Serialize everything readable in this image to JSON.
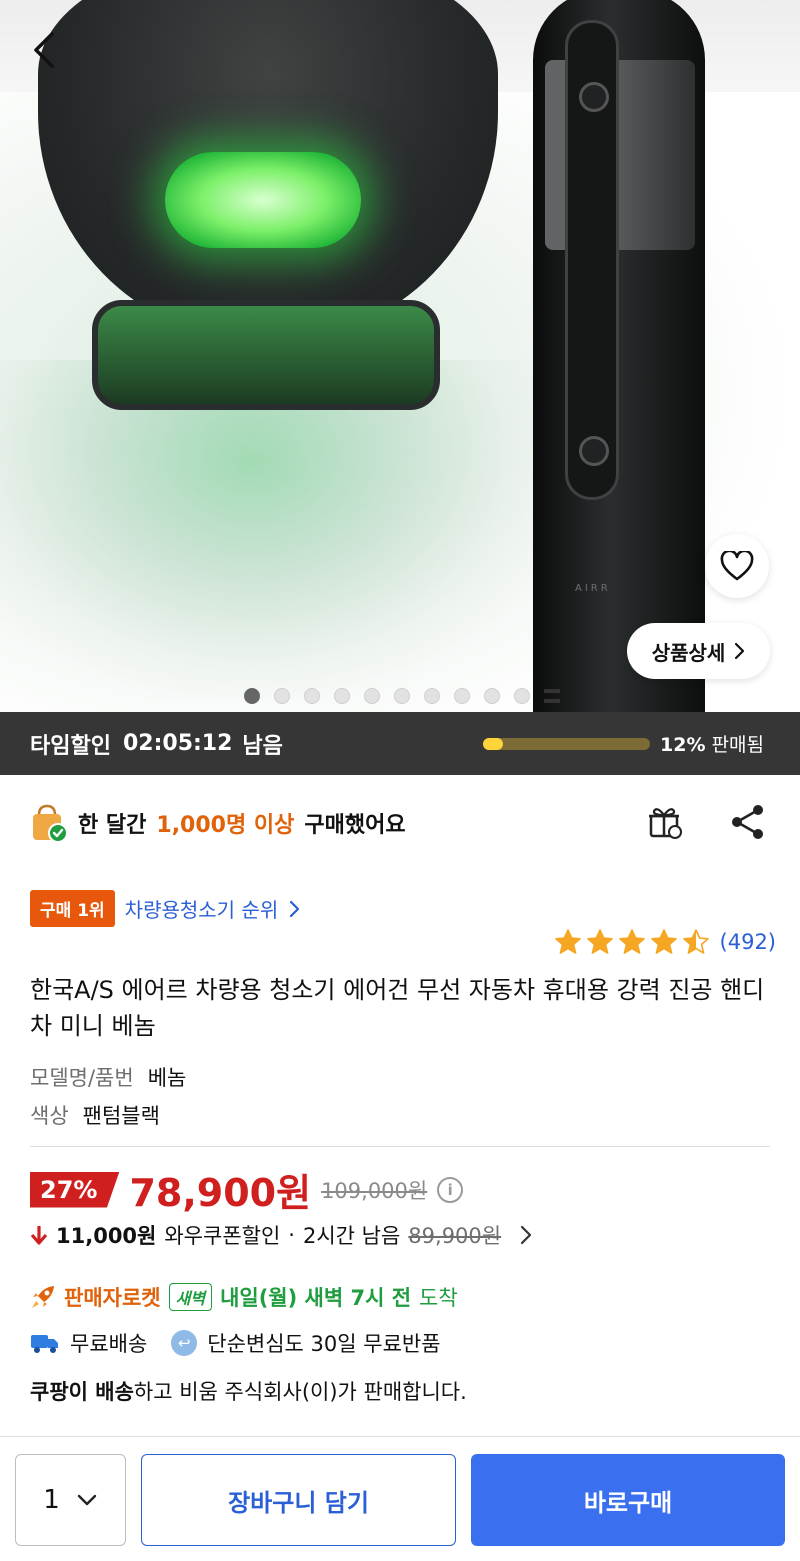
{
  "hero": {
    "brand_mark": "AIRR",
    "image_count": 10,
    "active_index": 0
  },
  "actions": {
    "detail_label": "상품상세"
  },
  "timedeal": {
    "label": "타임할인",
    "countdown": "02:05:12",
    "remain_suffix": "남음",
    "sold_percent_value": 12,
    "sold_percent": "12%",
    "sold_suffix": "판매됨"
  },
  "purchase_banner": {
    "prefix": "한 달간",
    "highlight": "1,000명 이상",
    "suffix": "구매했어요"
  },
  "rank": {
    "badge": "구매 1위",
    "category_link": "차량용청소기 순위"
  },
  "rating": {
    "stars": 4.5,
    "count": "(492)"
  },
  "product": {
    "title": "한국A/S 에어르 차량용 청소기 에어건 무선 자동차 휴대용 강력 진공 핸디 차 미니 베놈",
    "specs": [
      {
        "key": "모델명/품번",
        "value": "베놈"
      },
      {
        "key": "색상",
        "value": "팬텀블랙"
      }
    ]
  },
  "price": {
    "discount": "27%",
    "sale_price": "78,900원",
    "original_price": "109,000원"
  },
  "coupon": {
    "amount": "11,000원",
    "label": "와우쿠폰할인",
    "separator": "·",
    "time_left": "2시간 남음",
    "coupon_price": "89,900원"
  },
  "delivery": {
    "rocket_label": "판매자로켓",
    "dawn_badge": "새벽",
    "arrival": "내일(월) 새벽 7시 전",
    "arrival_suffix": "도착"
  },
  "shipping": {
    "free_shipping": "무료배송",
    "free_return": "단순변심도 30일 무료반품"
  },
  "seller": {
    "bold_part": "쿠팡이 배송",
    "rest": "하고 비움 주식회사(이)가 판매합니다."
  },
  "bottom_bar": {
    "quantity": "1",
    "cart_label": "장바구니 담기",
    "buy_label": "바로구매"
  },
  "colors": {
    "accent_blue": "#3a6ff0",
    "price_red": "#cf1f1f",
    "orange": "#e0620a",
    "green": "#1f9d3f"
  }
}
